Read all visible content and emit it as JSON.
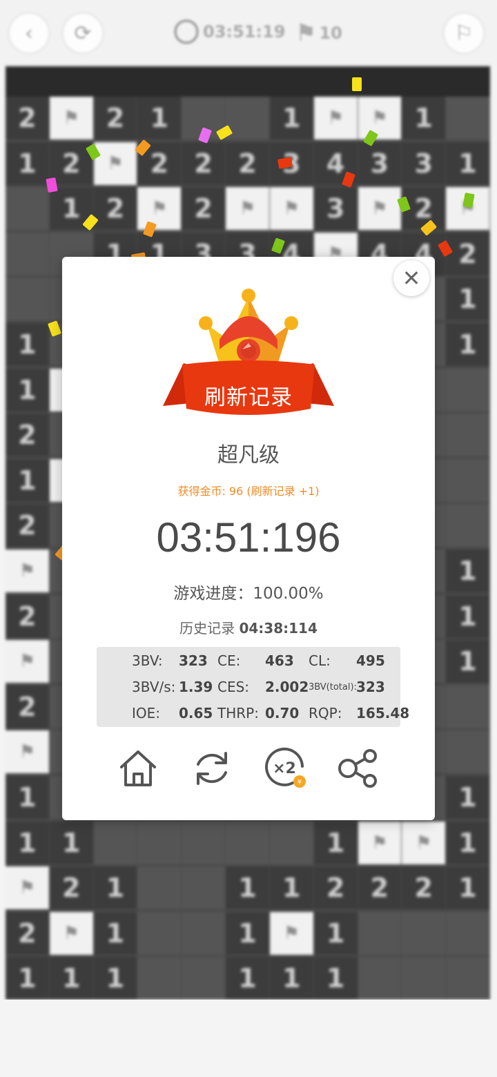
{
  "topbar": {
    "back_icon": "chevron-left-icon",
    "restart_icon": "refresh-icon",
    "timer_text": "03:51:19",
    "flags_text": "10",
    "right_icon": "flag-outline-icon"
  },
  "board": {
    "rows": [
      [
        "2",
        "F",
        "2",
        "1",
        "",
        "",
        "1",
        "F",
        "F",
        "1",
        ""
      ],
      [
        "1",
        "2",
        "F",
        "2",
        "2",
        "2",
        "3",
        "4",
        "3",
        "3",
        "1"
      ],
      [
        "",
        "1",
        "2",
        "F",
        "2",
        "F",
        "F",
        "3",
        "F",
        "2",
        "F"
      ],
      [
        "",
        "",
        "1",
        "1",
        "3",
        "3",
        "4",
        "F",
        "4",
        "4",
        "2"
      ],
      [
        "",
        "",
        "",
        "",
        "",
        "",
        "",
        "",
        "",
        "",
        "1"
      ],
      [
        "1",
        "",
        "",
        "",
        "",
        "",
        "",
        "",
        "",
        "",
        "1"
      ],
      [
        "1",
        "F",
        "",
        "",
        "",
        "",
        "",
        "",
        "",
        "",
        ""
      ],
      [
        "2",
        "",
        "",
        "",
        "",
        "",
        "",
        "",
        "",
        "",
        ""
      ],
      [
        "1",
        "F",
        "",
        "",
        "",
        "",
        "",
        "",
        "",
        "",
        ""
      ],
      [
        "2",
        "",
        "",
        "",
        "",
        "",
        "",
        "",
        "",
        "",
        ""
      ],
      [
        "F",
        "",
        "",
        "",
        "",
        "",
        "",
        "",
        "",
        "",
        "1"
      ],
      [
        "2",
        "",
        "",
        "",
        "",
        "",
        "",
        "",
        "",
        "",
        "1"
      ],
      [
        "F",
        "",
        "",
        "",
        "",
        "",
        "",
        "",
        "",
        "",
        "1"
      ],
      [
        "2",
        "",
        "",
        "",
        "",
        "",
        "",
        "",
        "",
        "",
        ""
      ],
      [
        "F",
        "",
        "",
        "",
        "",
        "",
        "",
        "",
        "",
        "",
        ""
      ],
      [
        "1",
        "",
        "",
        "",
        "",
        "",
        "",
        "",
        "",
        "",
        "1"
      ],
      [
        "1",
        "1",
        "",
        "",
        "",
        "",
        "",
        "1",
        "F",
        "F",
        "1"
      ],
      [
        "F",
        "2",
        "1",
        "",
        "",
        "1",
        "1",
        "2",
        "2",
        "2",
        "1"
      ],
      [
        "2",
        "F",
        "1",
        "",
        "",
        "1",
        "F",
        "1",
        "",
        "",
        ""
      ],
      [
        "1",
        "1",
        "1",
        "",
        "",
        "1",
        "1",
        "1",
        "",
        "",
        ""
      ]
    ],
    "flag_glyph": "⚑"
  },
  "dialog": {
    "close_icon": "close-icon",
    "badge_text": "刷新记录",
    "level": "超凡级",
    "coins_text": "获得金币: 96 (刷新记录 +1)",
    "time": "03:51:196",
    "progress_text": "游戏进度：100.00%",
    "history_label": "历史记录",
    "history_value": "04:38:114",
    "stats": {
      "row1": {
        "l1": "3BV:",
        "v1": "323",
        "l2": "CE:",
        "v2": "463",
        "l3": "CL:",
        "v3": "495"
      },
      "row2": {
        "l1": "3BV/s:",
        "v1": "1.39",
        "l2": "CES:",
        "v2": "2.002",
        "l3": "3BV(total):",
        "v3": "323"
      },
      "row3": {
        "l1": "IOE:",
        "v1": "0.65",
        "l2": "THRP:",
        "v2": "0.70",
        "l3": "RQP:",
        "v3": "165.48"
      }
    },
    "actions": [
      "home-icon",
      "replay-icon",
      "double-coins-icon",
      "share-icon"
    ]
  },
  "colors": {
    "ribbon": "#e8380f",
    "crown_yellow": "#f7c21b",
    "crown_orange": "#f19a21",
    "coins_text": "#f08a24",
    "board_cell": "#3c3c3c",
    "flag_cell": "#f1f1f1"
  }
}
